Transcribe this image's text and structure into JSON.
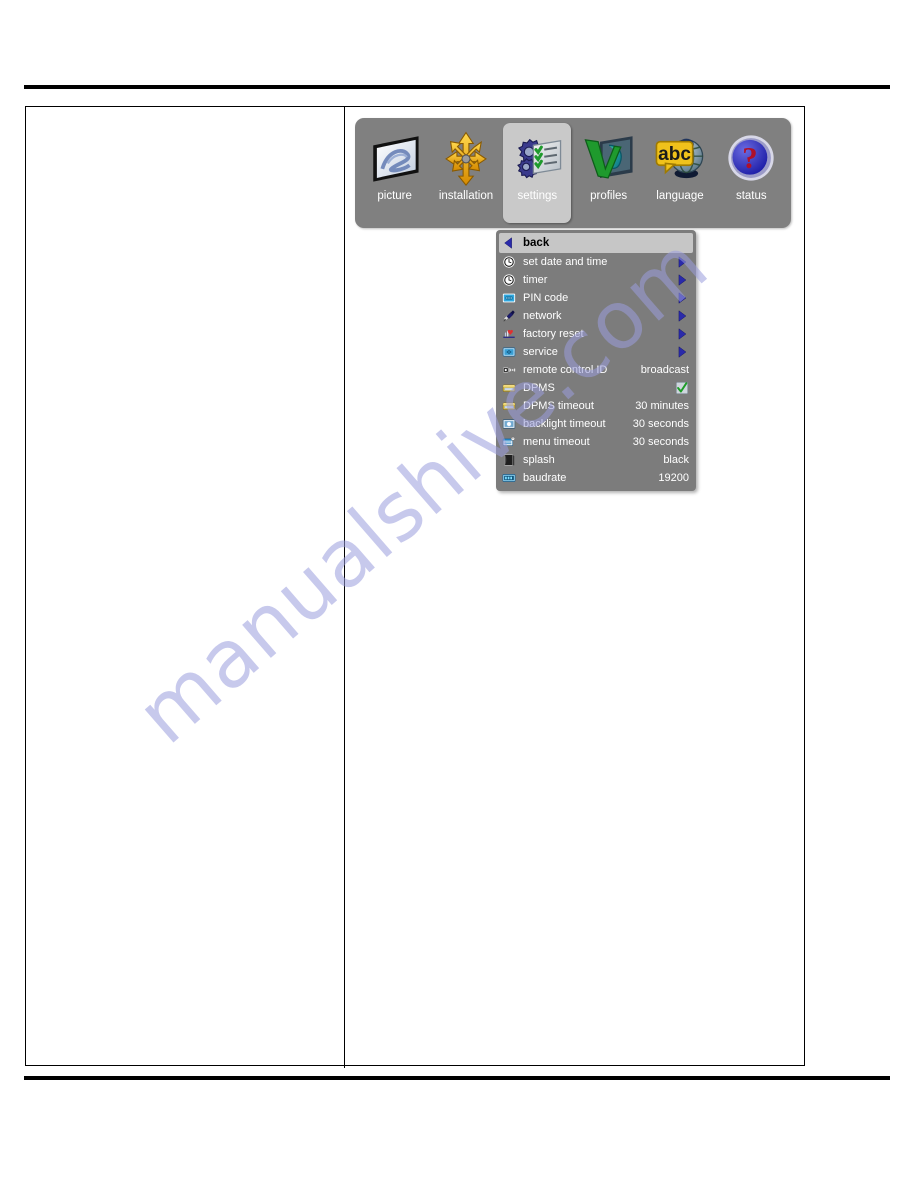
{
  "page": {
    "watermark": "manualshive.com"
  },
  "osd": {
    "toolbar": {
      "tabs": [
        {
          "label": "picture",
          "icon": "picture-icon",
          "selected": false
        },
        {
          "label": "installation",
          "icon": "installation-icon",
          "selected": false
        },
        {
          "label": "settings",
          "icon": "settings-icon",
          "selected": true
        },
        {
          "label": "profiles",
          "icon": "profiles-icon",
          "selected": false
        },
        {
          "label": "language",
          "icon": "language-icon",
          "selected": false
        },
        {
          "label": "status",
          "icon": "status-icon",
          "selected": false
        }
      ]
    },
    "menu": {
      "rows": [
        {
          "label": "back",
          "icon": "back-arrow-icon",
          "value": "",
          "control": "none",
          "highlight": true
        },
        {
          "label": "set date and time",
          "icon": "clock-icon",
          "value": "",
          "control": "submenu",
          "highlight": false
        },
        {
          "label": "timer",
          "icon": "clock-icon",
          "value": "",
          "control": "submenu",
          "highlight": false
        },
        {
          "label": "PIN code",
          "icon": "pin-code-icon",
          "value": "",
          "control": "submenu",
          "highlight": false
        },
        {
          "label": "network",
          "icon": "network-plug-icon",
          "value": "",
          "control": "submenu",
          "highlight": false
        },
        {
          "label": "factory reset",
          "icon": "factory-reset-icon",
          "value": "",
          "control": "submenu",
          "highlight": false
        },
        {
          "label": "service",
          "icon": "service-icon",
          "value": "",
          "control": "submenu",
          "highlight": false
        },
        {
          "label": "remote control ID",
          "icon": "remote-control-icon",
          "value": "broadcast",
          "control": "value",
          "highlight": false
        },
        {
          "label": "DPMS",
          "icon": "dpms-icon",
          "value": "",
          "control": "checkbox",
          "highlight": false
        },
        {
          "label": "DPMS timeout",
          "icon": "dpms-icon",
          "value": "30 minutes",
          "control": "value",
          "highlight": false
        },
        {
          "label": "backlight timeout",
          "icon": "backlight-icon",
          "value": "30 seconds",
          "control": "value",
          "highlight": false
        },
        {
          "label": "menu timeout",
          "icon": "menu-timeout-icon",
          "value": "30 seconds",
          "control": "value",
          "highlight": false
        },
        {
          "label": "splash",
          "icon": "splash-icon",
          "value": "black",
          "control": "value",
          "highlight": false
        },
        {
          "label": "baudrate",
          "icon": "baudrate-icon",
          "value": "19200",
          "control": "value",
          "highlight": false
        }
      ]
    },
    "colors": {
      "panel_gray": "#808080",
      "menu_gray": "#7c7c7c",
      "highlight_gray": "#c6c6c6",
      "submenu_arrow_blue": "#2a2aaa",
      "check_green": "#1d9c27",
      "label_white": "#ffffff"
    }
  }
}
